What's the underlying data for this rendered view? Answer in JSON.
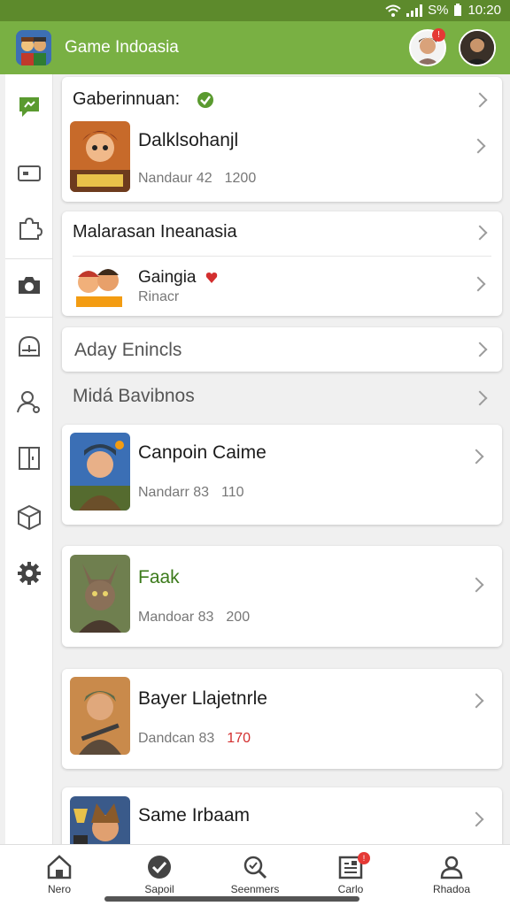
{
  "status_bar": {
    "battery_text": "S%",
    "time": "10:20"
  },
  "app_bar": {
    "title": "Game Indoasia",
    "notification_count": "!"
  },
  "rail_icons": [
    "chat-bubble-icon",
    "card-icon",
    "puzzle-icon",
    "camera-icon",
    "dashboard-icon",
    "user-search-icon",
    "panel-icon",
    "box-icon",
    "settings-icon"
  ],
  "sections": {
    "first": {
      "header": "Gaberinnuan:",
      "game_title": "Dalklsohanjl",
      "meta_label": "Nandaur 42",
      "meta_num": "1200"
    },
    "second": {
      "header": "Malarasan Ineanasia",
      "game_title": "Gaingia",
      "game_sub": "Rinacr"
    },
    "row_a": "Aday Enincls",
    "row_b": "Midá Bavibnos"
  },
  "game_cards": [
    {
      "title": "Canpoin Caime",
      "meta_label": "Nandarr 83",
      "meta_num": "110",
      "highlight": false,
      "red": false
    },
    {
      "title": "Faak",
      "meta_label": "Mandoar 83",
      "meta_num": "200",
      "highlight": true,
      "red": false
    },
    {
      "title": "Bayer Llajetnrle",
      "meta_label": "Dandcan 83",
      "meta_num": "170",
      "highlight": false,
      "red": true
    },
    {
      "title": "Same Irbaam",
      "meta_label": "",
      "meta_num": "",
      "highlight": false,
      "red": false
    }
  ],
  "bottom_nav": [
    {
      "label": "Nero",
      "icon": "home-icon"
    },
    {
      "label": "Sapoil",
      "icon": "check-circle-icon"
    },
    {
      "label": "Seenmers",
      "icon": "search-icon"
    },
    {
      "label": "Carlo",
      "icon": "document-list-icon",
      "badge": "!"
    },
    {
      "label": "Rhadoa",
      "icon": "profile-icon"
    }
  ],
  "colors": {
    "app_bar": "#79b043",
    "status_bar": "#5d8a2c",
    "highlight_title": "#3b7a1a",
    "badge_red": "#e53935"
  }
}
